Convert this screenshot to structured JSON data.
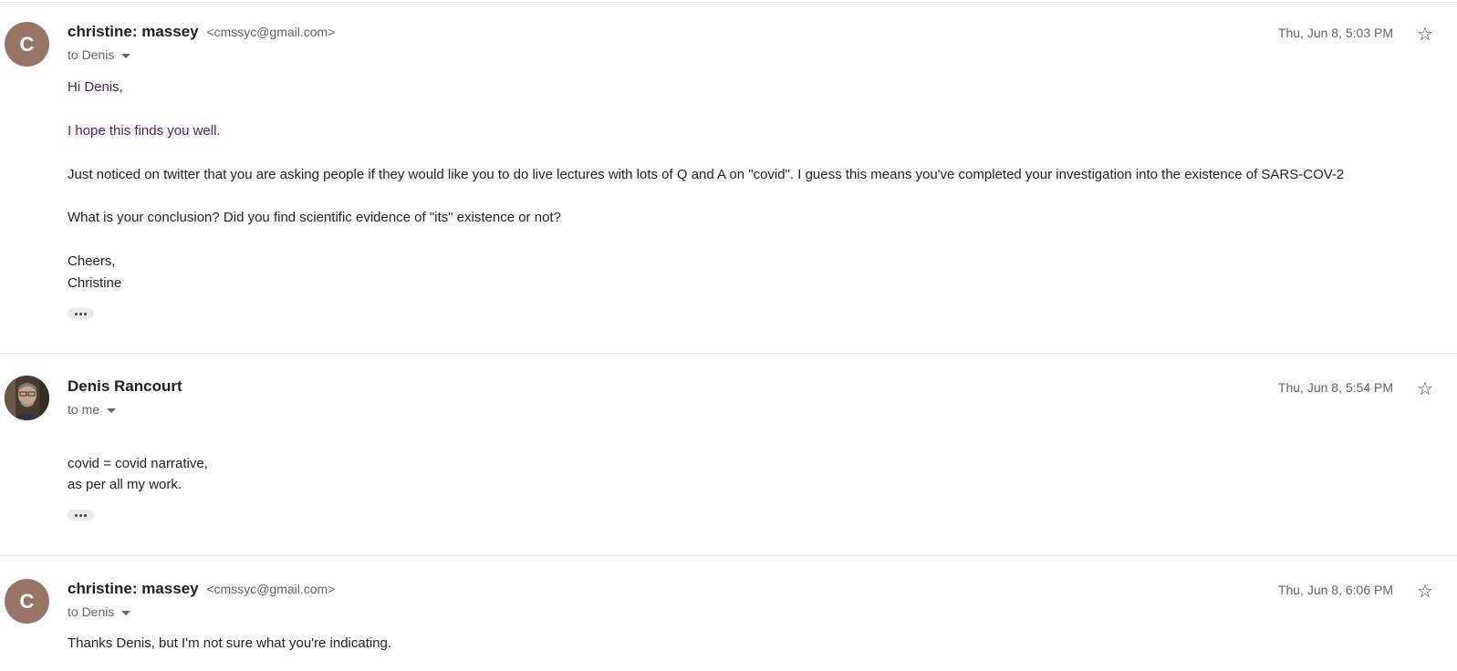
{
  "messages": [
    {
      "avatar_letter": "C",
      "sender_name": "christine: massey",
      "sender_email": "<cmssyc@gmail.com>",
      "recipient": "to Denis",
      "date": "Thu, Jun 8, 5:03 PM",
      "body": [
        "Hi Denis,",
        "I hope this finds you well.",
        "Just noticed on twitter that you are asking people if they would like you to do live lectures with lots of Q and A on \"covid\".  I guess this means you've completed your investigation into the existence of SARS-COV-2",
        "What is your conclusion?  Did you find scientific evidence of \"its\" existence or not?",
        "Cheers,",
        "Christine"
      ]
    },
    {
      "sender_name": "Denis Rancourt",
      "recipient": "to me",
      "date": "Thu, Jun 8, 5:54 PM",
      "body": [
        "covid = covid narrative,",
        "as per all my work."
      ]
    },
    {
      "avatar_letter": "C",
      "sender_name": "christine: massey",
      "sender_email": "<cmssyc@gmail.com>",
      "recipient": "to Denis",
      "date": "Thu, Jun 8, 6:06 PM",
      "body": [
        "Thanks Denis, but I'm not sure what you're indicating."
      ]
    }
  ],
  "icons": {
    "star": "☆",
    "show_trimmed": "show-trimmed-content-icon",
    "recipient_details": "caret-down-icon"
  }
}
